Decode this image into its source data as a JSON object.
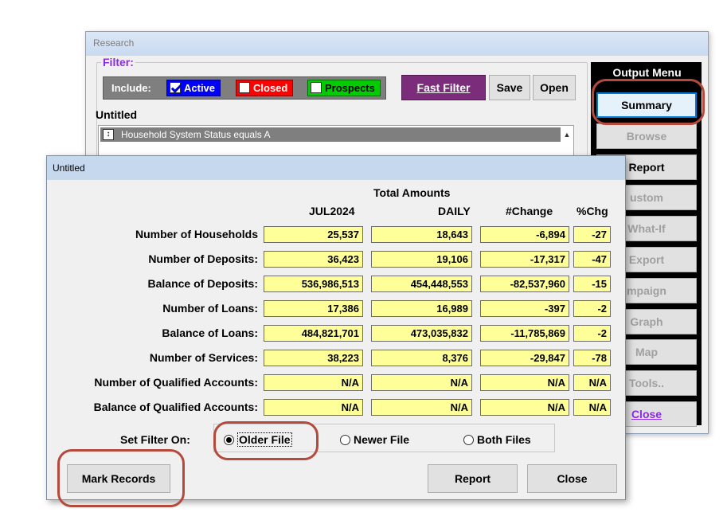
{
  "research_window": {
    "title": "Research",
    "filter_label": "Filter:",
    "include_label": "Include:",
    "include_options": [
      {
        "label": "Active",
        "checked": true,
        "color": "#0000ff"
      },
      {
        "label": "Closed",
        "checked": false,
        "color": "#ff0000"
      },
      {
        "label": "Prospects",
        "checked": false,
        "color": "#00cc00"
      }
    ],
    "fast_filter_label": "Fast Filter",
    "save_label": "Save",
    "open_label": "Open",
    "filter_name": "Untitled",
    "criteria": [
      "Household System Status equals A"
    ]
  },
  "output_menu": {
    "title": "Output Menu",
    "items": [
      {
        "label": "Summary",
        "state": "selected"
      },
      {
        "label": "Browse",
        "state": "disabled"
      },
      {
        "label": "Report",
        "state": "enabled"
      },
      {
        "label": "ustom",
        "state": "disabled"
      },
      {
        "label": "What-If",
        "state": "disabled"
      },
      {
        "label": "Export",
        "state": "disabled"
      },
      {
        "label": "mpaign",
        "state": "disabled"
      },
      {
        "label": "Graph",
        "state": "disabled"
      },
      {
        "label": "Map",
        "state": "disabled"
      },
      {
        "label": "Tools..",
        "state": "disabled"
      },
      {
        "label": "Close",
        "state": "purple"
      }
    ]
  },
  "summary_window": {
    "title": "Untitled",
    "group_header": "Total Amounts",
    "columns": [
      "JUL2024",
      "DAILY",
      "#Change",
      "%Chg"
    ],
    "rows": [
      {
        "label": "Number of Households",
        "values": [
          "25,537",
          "18,643",
          "-6,894",
          "-27"
        ]
      },
      {
        "label": "Number of Deposits:",
        "values": [
          "36,423",
          "19,106",
          "-17,317",
          "-47"
        ]
      },
      {
        "label": "Balance of Deposits:",
        "values": [
          "536,986,513",
          "454,448,553",
          "-82,537,960",
          "-15"
        ]
      },
      {
        "label": "Number of Loans:",
        "values": [
          "17,386",
          "16,989",
          "-397",
          "-2"
        ]
      },
      {
        "label": "Balance of Loans:",
        "values": [
          "484,821,701",
          "473,035,832",
          "-11,785,869",
          "-2"
        ]
      },
      {
        "label": "Number of Services:",
        "values": [
          "38,223",
          "8,376",
          "-29,847",
          "-78"
        ]
      },
      {
        "label": "Number of Qualified Accounts:",
        "values": [
          "N/A",
          "N/A",
          "N/A",
          "N/A"
        ]
      },
      {
        "label": "Balance of Qualified Accounts:",
        "values": [
          "N/A",
          "N/A",
          "N/A",
          "N/A"
        ]
      }
    ],
    "set_filter_label": "Set Filter On:",
    "filter_options": [
      {
        "label": "Older File",
        "selected": true
      },
      {
        "label": "Newer File",
        "selected": false
      },
      {
        "label": "Both Files",
        "selected": false
      }
    ],
    "mark_records_label": "Mark Records",
    "report_label": "Report",
    "close_label": "Close"
  },
  "colors": {
    "cell_fill": "#ffff99",
    "highlight": "#b54a3c",
    "menu_accent": "#8b2be2",
    "fast_filter": "#7b2d7b"
  }
}
